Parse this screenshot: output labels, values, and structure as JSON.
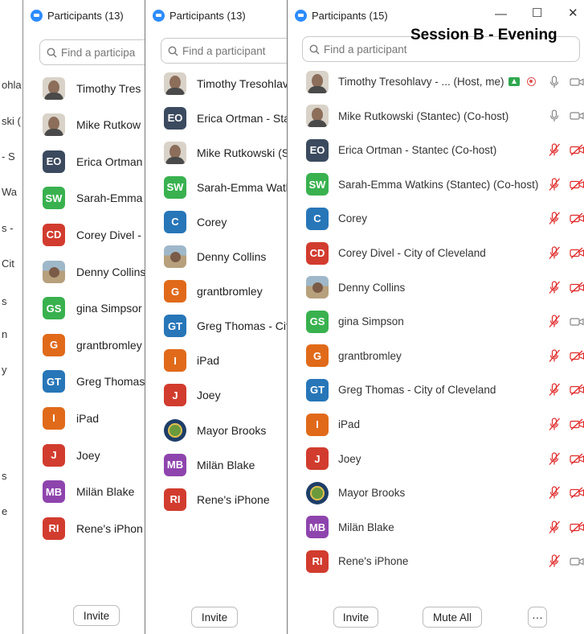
{
  "overlay": {
    "session_label": "Session B - Evening"
  },
  "leftmost": {
    "fragments": [
      "ohla",
      "ski (",
      "- S",
      "Wa",
      "s -",
      "Cit",
      "s",
      "n",
      "y",
      "s",
      "e"
    ]
  },
  "panel_a": {
    "title": "Participants (13)",
    "search_placeholder": "Find a participa",
    "participants": [
      {
        "initials": "",
        "photo": "face",
        "name": "Timothy Tres"
      },
      {
        "initials": "",
        "photo": "face",
        "name": "Mike Rutkow"
      },
      {
        "initials": "EO",
        "color": "#3b4a5e",
        "name": "Erica Ortman"
      },
      {
        "initials": "SW",
        "color": "#39b14f",
        "name": "Sarah-Emma"
      },
      {
        "initials": "CD",
        "color": "#d13c2e",
        "name": "Corey Divel -"
      },
      {
        "initials": "",
        "photo": "outdoor",
        "name": "Denny Collins"
      },
      {
        "initials": "GS",
        "color": "#39b14f",
        "name": "gina Simpsor"
      },
      {
        "initials": "G",
        "color": "#e06a1a",
        "name": "grantbromley"
      },
      {
        "initials": "GT",
        "color": "#2776b8",
        "name": "Greg Thomas"
      },
      {
        "initials": "I",
        "color": "#e06a1a",
        "name": "iPad"
      },
      {
        "initials": "J",
        "color": "#d13c2e",
        "name": "Joey"
      },
      {
        "initials": "MB",
        "color": "#8e44ad",
        "name": "Milän Blake"
      },
      {
        "initials": "RI",
        "color": "#d13c2e",
        "name": "Rene's iPhon"
      }
    ],
    "invite_label": "Invite"
  },
  "panel_b": {
    "title": "Participants (13)",
    "search_placeholder": "Find a participant",
    "participants": [
      {
        "initials": "",
        "photo": "face",
        "name": "Timothy Tresohlavy"
      },
      {
        "initials": "EO",
        "color": "#3b4a5e",
        "name": "Erica Ortman - Sta"
      },
      {
        "initials": "",
        "photo": "face",
        "name": "Mike Rutkowski (St"
      },
      {
        "initials": "SW",
        "color": "#39b14f",
        "name": "Sarah-Emma Watk"
      },
      {
        "initials": "C",
        "color": "#2776b8",
        "name": "Corey"
      },
      {
        "initials": "",
        "photo": "outdoor",
        "name": "Denny Collins"
      },
      {
        "initials": "G",
        "color": "#e06a1a",
        "name": "grantbromley"
      },
      {
        "initials": "GT",
        "color": "#2776b8",
        "name": "Greg Thomas - Cit"
      },
      {
        "initials": "I",
        "color": "#e06a1a",
        "name": "iPad"
      },
      {
        "initials": "J",
        "color": "#d13c2e",
        "name": "Joey"
      },
      {
        "initials": "",
        "photo": "seal",
        "name": "Mayor Brooks"
      },
      {
        "initials": "MB",
        "color": "#8e44ad",
        "name": "Milän Blake"
      },
      {
        "initials": "RI",
        "color": "#d13c2e",
        "name": "Rene's iPhone"
      }
    ],
    "invite_label": "Invite"
  },
  "panel_c": {
    "title": "Participants (15)",
    "search_placeholder": "Find a participant",
    "participants": [
      {
        "initials": "",
        "photo": "face",
        "name": "Timothy Tresohlavy - ...  (Host, me)",
        "host": true,
        "audio": "on",
        "video": "off-gray"
      },
      {
        "initials": "",
        "photo": "face",
        "name": "Mike Rutkowski (Stantec) (Co-host)",
        "audio": "on",
        "video": "off-gray"
      },
      {
        "initials": "EO",
        "color": "#3b4a5e",
        "name": "Erica Ortman - Stantec (Co-host)",
        "audio": "muted",
        "video": "off"
      },
      {
        "initials": "SW",
        "color": "#39b14f",
        "name": "Sarah-Emma Watkins (Stantec) (Co-host)",
        "audio": "muted",
        "video": "off"
      },
      {
        "initials": "C",
        "color": "#2776b8",
        "name": "Corey",
        "audio": "muted",
        "video": "off"
      },
      {
        "initials": "CD",
        "color": "#d13c2e",
        "name": "Corey Divel - City of Cleveland",
        "audio": "muted",
        "video": "off"
      },
      {
        "initials": "",
        "photo": "outdoor",
        "name": "Denny Collins",
        "audio": "muted",
        "video": "off"
      },
      {
        "initials": "GS",
        "color": "#39b14f",
        "name": "gina Simpson",
        "audio": "muted",
        "video": "off-gray"
      },
      {
        "initials": "G",
        "color": "#e06a1a",
        "name": "grantbromley",
        "audio": "muted",
        "video": "off"
      },
      {
        "initials": "GT",
        "color": "#2776b8",
        "name": "Greg Thomas - City of Cleveland",
        "audio": "muted",
        "video": "off"
      },
      {
        "initials": "I",
        "color": "#e06a1a",
        "name": "iPad",
        "audio": "muted",
        "video": "off"
      },
      {
        "initials": "J",
        "color": "#d13c2e",
        "name": "Joey",
        "audio": "muted",
        "video": "off"
      },
      {
        "initials": "",
        "photo": "seal",
        "name": "Mayor Brooks",
        "audio": "muted",
        "video": "off"
      },
      {
        "initials": "MB",
        "color": "#8e44ad",
        "name": "Milän Blake",
        "audio": "muted",
        "video": "off"
      },
      {
        "initials": "RI",
        "color": "#d13c2e",
        "name": "Rene's iPhone",
        "audio": "muted",
        "video": "off-gray"
      }
    ],
    "invite_label": "Invite",
    "mute_all_label": "Mute All",
    "more_label": "···"
  }
}
